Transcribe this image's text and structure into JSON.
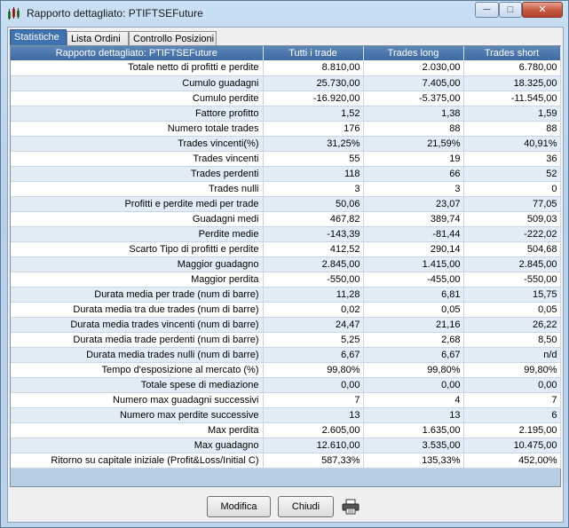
{
  "window": {
    "title": "Rapporto dettagliato: PTIFTSEFuture"
  },
  "titlebar_buttons": {
    "minimize": "─",
    "maximize": "□",
    "close": "✕"
  },
  "tabs": [
    {
      "label": "Statistiche",
      "active": true
    },
    {
      "label": "Lista Ordini",
      "active": false
    },
    {
      "label": "Controllo Posizioni",
      "active": false
    }
  ],
  "table": {
    "headers": [
      "Rapporto dettagliato: PTIFTSEFuture",
      "Tutti i trade",
      "Trades long",
      "Trades short"
    ],
    "rows": [
      [
        "Totale netto di profitti e perdite",
        "8.810,00",
        "2.030,00",
        "6.780,00"
      ],
      [
        "Cumulo guadagni",
        "25.730,00",
        "7.405,00",
        "18.325,00"
      ],
      [
        "Cumulo perdite",
        "-16.920,00",
        "-5.375,00",
        "-11.545,00"
      ],
      [
        "Fattore profitto",
        "1,52",
        "1,38",
        "1,59"
      ],
      [
        "Numero totale trades",
        "176",
        "88",
        "88"
      ],
      [
        "Trades vincenti(%)",
        "31,25%",
        "21,59%",
        "40,91%"
      ],
      [
        "Trades vincenti",
        "55",
        "19",
        "36"
      ],
      [
        "Trades perdenti",
        "118",
        "66",
        "52"
      ],
      [
        "Trades nulli",
        "3",
        "3",
        "0"
      ],
      [
        "Profitti e perdite medi per trade",
        "50,06",
        "23,07",
        "77,05"
      ],
      [
        "Guadagni medi",
        "467,82",
        "389,74",
        "509,03"
      ],
      [
        "Perdite medie",
        "-143,39",
        "-81,44",
        "-222,02"
      ],
      [
        "Scarto Tipo di profitti e perdite",
        "412,52",
        "290,14",
        "504,68"
      ],
      [
        "Maggior guadagno",
        "2.845,00",
        "1.415,00",
        "2.845,00"
      ],
      [
        "Maggior perdita",
        "-550,00",
        "-455,00",
        "-550,00"
      ],
      [
        "Durata media per trade (num di barre)",
        "11,28",
        "6,81",
        "15,75"
      ],
      [
        "Durata media tra due trades (num di barre)",
        "0,02",
        "0,05",
        "0,05"
      ],
      [
        "Durata media trades vincenti (num di barre)",
        "24,47",
        "21,16",
        "26,22"
      ],
      [
        "Durata media trade perdenti (num di barre)",
        "5,25",
        "2,68",
        "8,50"
      ],
      [
        "Durata media trades nulli (num di barre)",
        "6,67",
        "6,67",
        "n/d"
      ],
      [
        "Tempo d'esposizione al mercato (%)",
        "99,80%",
        "99,80%",
        "99,80%"
      ],
      [
        "Totale spese di mediazione",
        "0,00",
        "0,00",
        "0,00"
      ],
      [
        "Numero max guadagni successivi",
        "7",
        "4",
        "7"
      ],
      [
        "Numero max perdite successive",
        "13",
        "13",
        "6"
      ],
      [
        "Max perdita",
        "2.605,00",
        "1.635,00",
        "2.195,00"
      ],
      [
        "Max guadagno",
        "12.610,00",
        "3.535,00",
        "10.475,00"
      ],
      [
        "Ritorno su capitale iniziale (Profit&Loss/Initial C)",
        "587,33%",
        "135,33%",
        "452,00%"
      ]
    ]
  },
  "buttons": {
    "modifica": "Modifica",
    "chiudi": "Chiudi"
  },
  "icons": {
    "app": "chart-icon",
    "print": "printer-icon"
  },
  "colors": {
    "header_bg": "#3d6ba1",
    "row_alt": "#e2ecf6",
    "panel_bg": "#b7cee2"
  }
}
